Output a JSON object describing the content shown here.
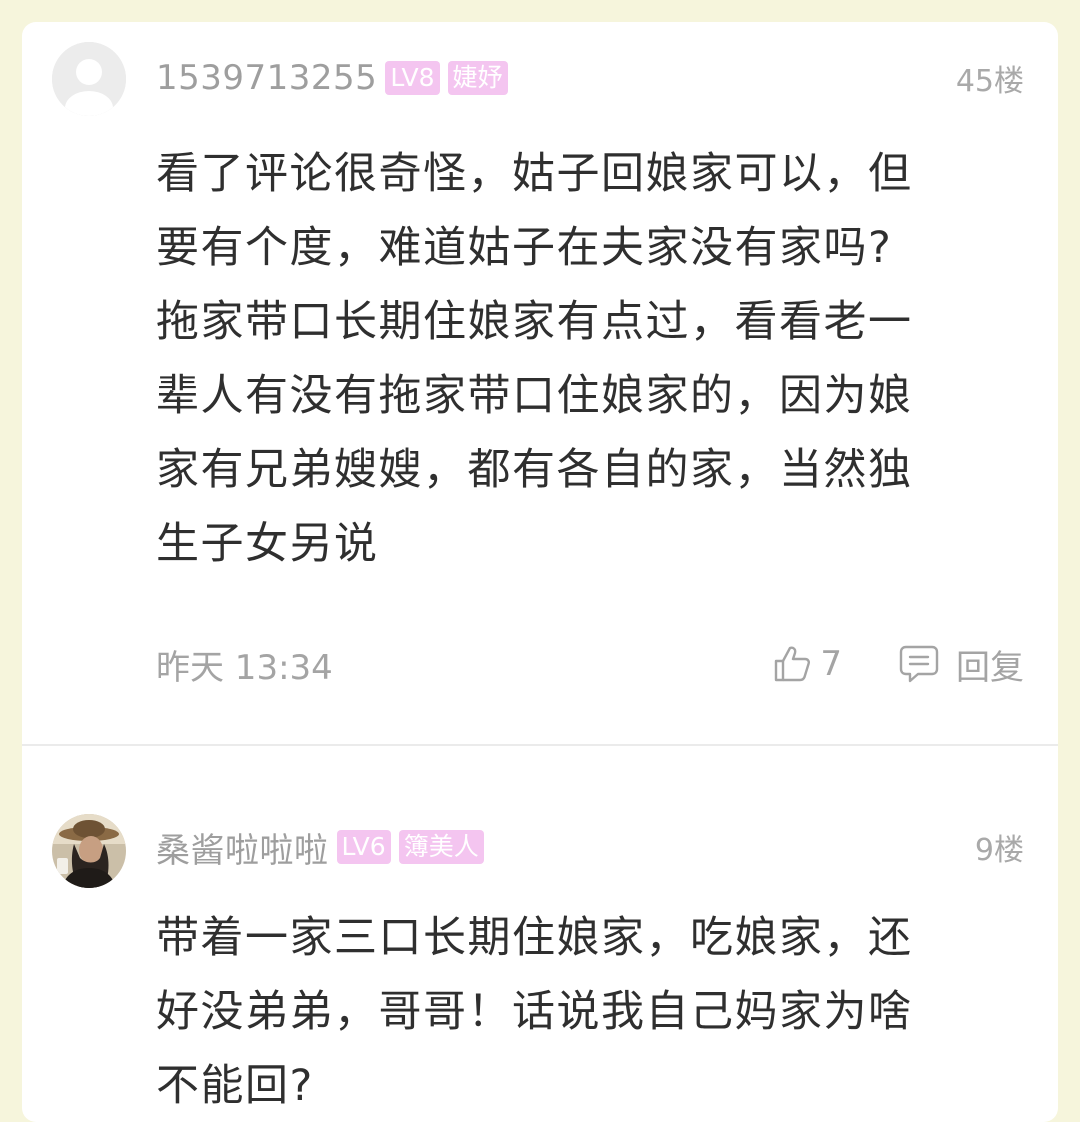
{
  "comments": [
    {
      "username": "1539713255",
      "level": "LV8",
      "title_badge": "婕妤",
      "floor": "45楼",
      "content": "看了评论很奇怪，姑子回娘家可以，但\n要有个度，难道姑子在夫家没有家吗?\n拖家带口长期住娘家有点过，看看老一\n辈人有没有拖家带口住娘家的，因为娘\n家有兄弟嫂嫂，都有各自的家，当然独\n生子女另说",
      "time": "昨天 13:34",
      "likes": "7",
      "reply_label": "回复",
      "avatar_icon": "default-avatar-icon"
    },
    {
      "username": "桑酱啦啦啦",
      "level": "LV6",
      "title_badge": "簿美人",
      "floor": "9楼",
      "content": "带着一家三口长期住娘家，吃娘家，还\n好没弟弟，哥哥！话说我自己妈家为啥\n不能回?",
      "avatar_icon": "photo-avatar"
    }
  ],
  "colors": {
    "background": "#f6f5dc",
    "card": "#ffffff",
    "badge": "#f4c5f0",
    "meta_text": "#a4a4a4",
    "body_text": "#2f2f2f"
  }
}
